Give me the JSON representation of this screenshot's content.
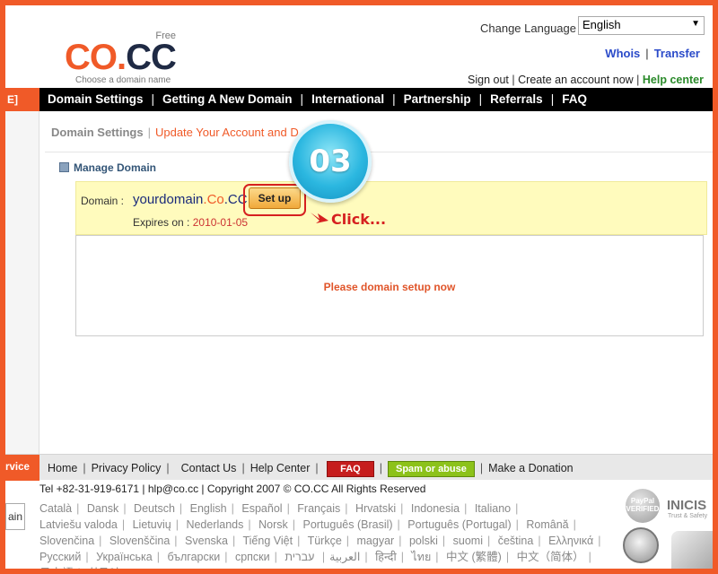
{
  "header": {
    "logo": {
      "free": "Free",
      "co": "CO",
      "dot": ".",
      "cc": "CC",
      "tagline": "Choose a domain name"
    },
    "change_language_label": "Change Language",
    "language_selected": "English",
    "whois": "Whois",
    "transfer": "Transfer",
    "sign_out": "Sign out",
    "create_account": "Create an account now",
    "help_center": "Help center"
  },
  "nav": {
    "left_stub": "E]",
    "items": [
      "Domain Settings",
      "Getting A New Domain",
      "International",
      "Partnership",
      "Referrals",
      "FAQ"
    ]
  },
  "breadcrumb": {
    "main": "Domain Settings",
    "sub": "Update Your Account and D"
  },
  "manage": {
    "title": "Manage Domain",
    "domain_label": "Domain :",
    "domain_name": "yourdomain",
    "domain_dot": ".",
    "domain_co": "Co",
    "domain_cc": ".CC",
    "setup_button": "Set up",
    "expires_label": "Expires on :",
    "expires_date": "2010-01-05",
    "panel_message": "Please domain setup now"
  },
  "annotation": {
    "step_number": "03",
    "click_label": "Click...",
    "highlight_color": "#d62020",
    "badge_color": "#2bb7e0"
  },
  "footer": {
    "left_stub": "rvice",
    "links": [
      "Home",
      "Privacy Policy",
      "Contact Us",
      "Help Center"
    ],
    "faq": "FAQ",
    "abuse": "Spam or abuse",
    "donation": "Make a Donation",
    "copyright": "Tel +82-31-919-6171 | hlp@co.cc | Copyright 2007 © CO.CC All Rights Reserved",
    "search_stub": "ain",
    "languages": [
      "Català",
      "Dansk",
      "Deutsch",
      "English",
      "Español",
      "Français",
      "Hrvatski",
      "Indonesia",
      "Italiano",
      "Latviešu valoda",
      "Lietuvių",
      "Nederlands",
      "Norsk",
      "Português (Brasil)",
      "Português (Portugal)",
      "Română",
      "Slovenčina",
      "Slovenščina",
      "Svenska",
      "Tiếng Việt",
      "Türkçe",
      "magyar",
      "polski",
      "suomi",
      "čeština",
      "Ελληνικά",
      "Русский",
      "Українська",
      "български",
      "српски",
      "العربية",
      "עברית",
      "हिन्दी",
      "ไทย",
      "中文 (繁體)",
      "中文（简体）",
      "日本語",
      "한국어"
    ],
    "paypal": "PayPal VERIFIED",
    "inicis": "INICIS",
    "inicis_sub": "Trust & Safety"
  },
  "colors": {
    "brand_orange": "#f05a28",
    "nav_bg": "#000000",
    "link_blue": "#2b4bc9",
    "help_green": "#2a8a2a",
    "highlight_yellow": "#fffbbd"
  }
}
